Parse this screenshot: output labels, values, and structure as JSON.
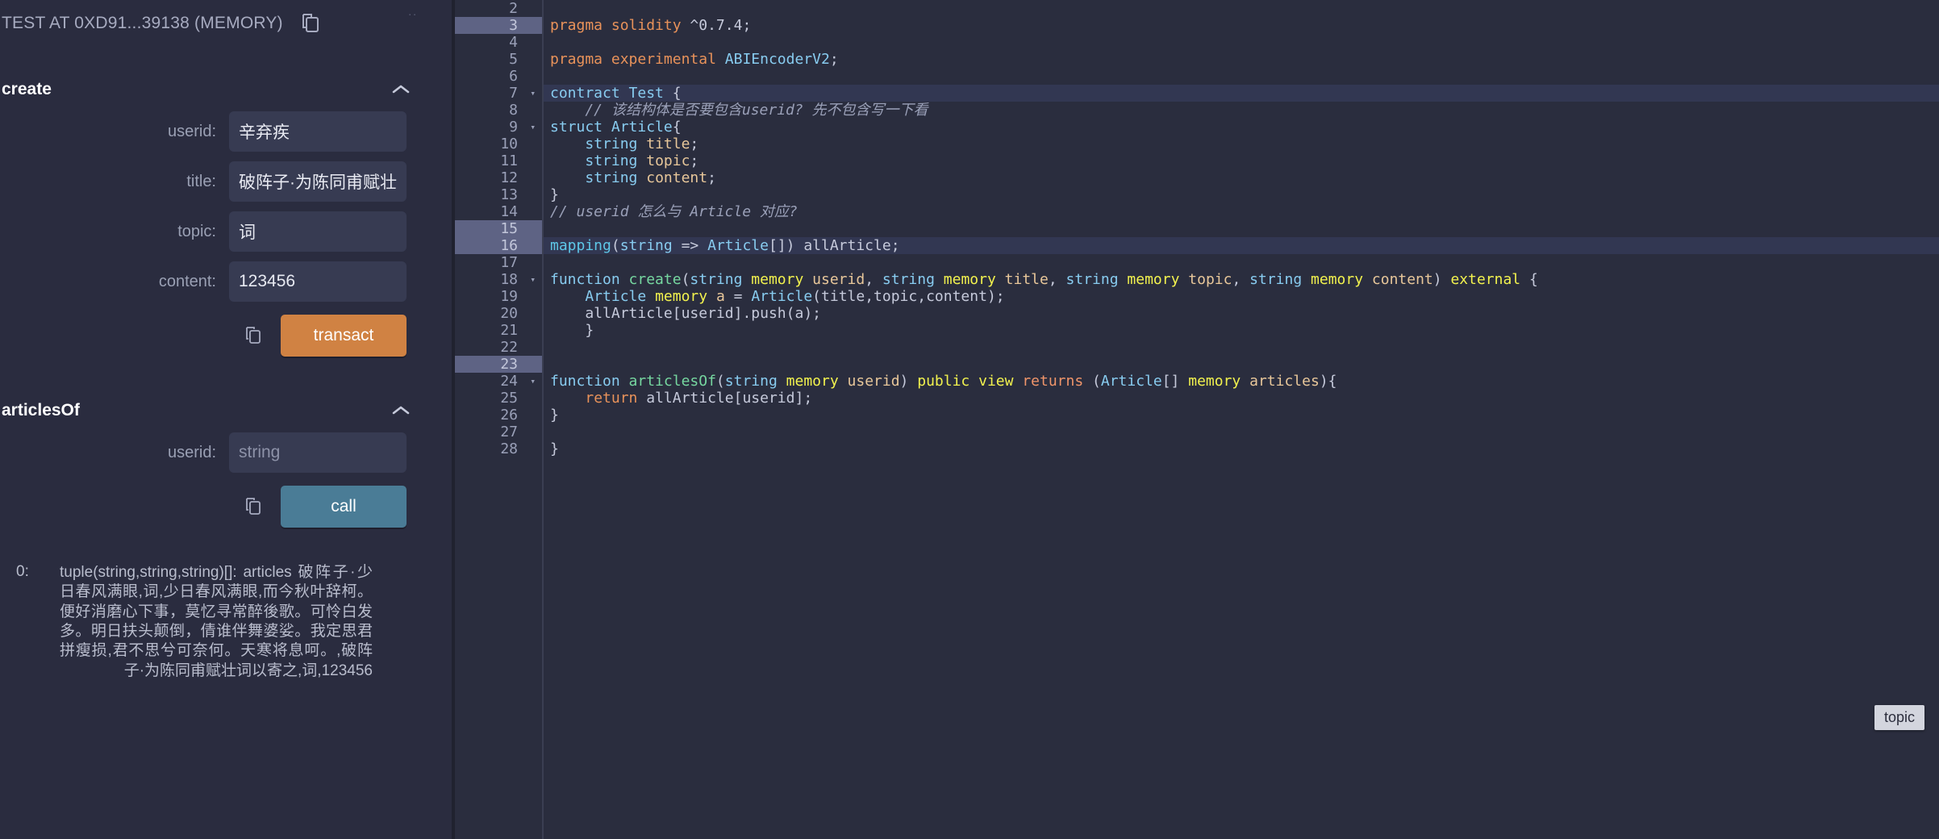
{
  "left_panel": {
    "contract_title": "TEST AT 0XD91...39138 (MEMORY)",
    "copy_address_icon": "copy-icon",
    "overflow_dots": "..",
    "functions": [
      {
        "name": "create",
        "collapse_icon": "chevron-up-icon",
        "fields": [
          {
            "label": "userid:",
            "value": "辛弃疾",
            "placeholder": "string"
          },
          {
            "label": "title:",
            "value": "破阵子·为陈同甫赋壮词以寄",
            "placeholder": "string"
          },
          {
            "label": "topic:",
            "value": "词",
            "placeholder": "string"
          },
          {
            "label": "content:",
            "value": "123456",
            "placeholder": "string"
          }
        ],
        "copy_icon": "copy-icon",
        "button_label": "transact",
        "button_color": "#d08243"
      },
      {
        "name": "articlesOf",
        "collapse_icon": "chevron-up-icon",
        "fields": [
          {
            "label": "userid:",
            "value": "",
            "placeholder": "string"
          }
        ],
        "copy_icon": "copy-icon",
        "button_label": "call",
        "button_color": "#4a7c96"
      }
    ],
    "result": {
      "index": "0:",
      "text": "tuple(string,string,string)[]: articles 破阵子·少日春风满眼,词,少日春风满眼,而今秋叶辞柯。便好消磨心下事，莫忆寻常醉後歌。可怜白发多。明日扶头颠倒，倩谁伴舞婆娑。我定思君拼瘦损,君不思兮可奈何。天寒将息呵。,破阵子·为陈同甫赋壮词以寄之,词,123456"
    }
  },
  "editor": {
    "tooltip": "topic",
    "first_visible_line": 2,
    "active_lines": [
      3,
      15,
      16,
      23
    ],
    "fold_lines": [
      7,
      9,
      18,
      24
    ],
    "lines": [
      {
        "n": 2,
        "code": ""
      },
      {
        "n": 3,
        "code": "pragma solidity ^0.7.4;"
      },
      {
        "n": 4,
        "code": ""
      },
      {
        "n": 5,
        "code": "pragma experimental ABIEncoderV2;"
      },
      {
        "n": 6,
        "code": ""
      },
      {
        "n": 7,
        "code": "contract Test {"
      },
      {
        "n": 8,
        "code": "    // 该结构体是否要包含userid? 先不包含写一下看"
      },
      {
        "n": 9,
        "code": "struct Article{"
      },
      {
        "n": 10,
        "code": "    string title;"
      },
      {
        "n": 11,
        "code": "    string topic;"
      },
      {
        "n": 12,
        "code": "    string content;"
      },
      {
        "n": 13,
        "code": "}"
      },
      {
        "n": 14,
        "code": "// userid 怎么与 Article 对应?"
      },
      {
        "n": 15,
        "code": ""
      },
      {
        "n": 16,
        "code": "mapping(string => Article[]) allArticle;"
      },
      {
        "n": 17,
        "code": ""
      },
      {
        "n": 18,
        "code": "function create(string memory userid, string memory title, string memory topic, string memory content) external {"
      },
      {
        "n": 19,
        "code": "    Article memory a = Article(title,topic,content);"
      },
      {
        "n": 20,
        "code": "    allArticle[userid].push(a);"
      },
      {
        "n": 21,
        "code": "    }"
      },
      {
        "n": 22,
        "code": ""
      },
      {
        "n": 23,
        "code": ""
      },
      {
        "n": 24,
        "code": "function articlesOf(string memory userid) public view returns (Article[] memory articles){"
      },
      {
        "n": 25,
        "code": "    return allArticle[userid];"
      },
      {
        "n": 26,
        "code": "}"
      },
      {
        "n": 27,
        "code": ""
      },
      {
        "n": 28,
        "code": "}"
      }
    ]
  },
  "colors": {
    "background": "#2a2c3f",
    "editor_background": "#2a2d3e",
    "accent_transact": "#d08243",
    "accent_call": "#4a7c96",
    "line_highlight": "#5e6384"
  }
}
